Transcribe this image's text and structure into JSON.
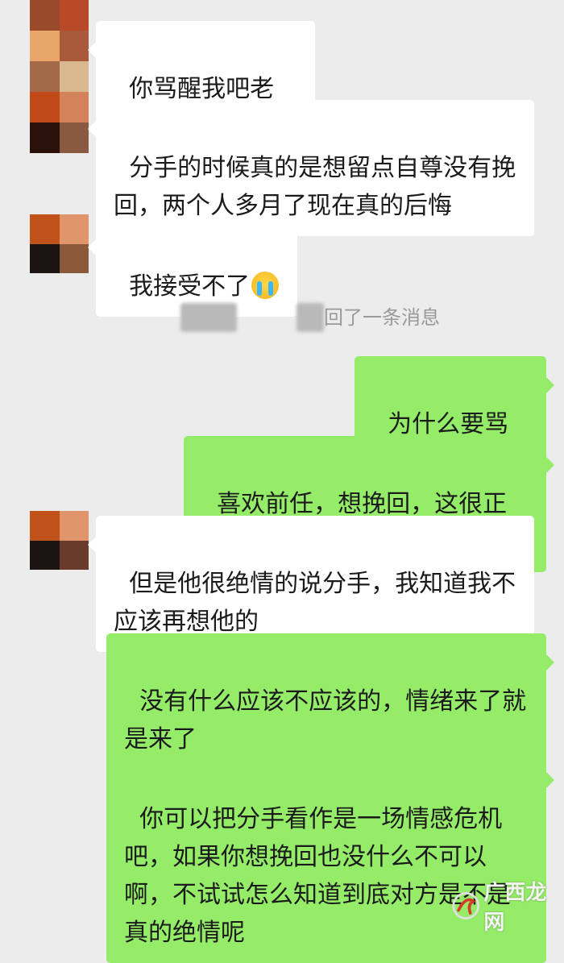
{
  "messages": [
    {
      "side": "in",
      "text": "你骂醒我吧老师"
    },
    {
      "side": "in",
      "text": "分手的时候真的是想留点自尊没有挽回，两个人多月了现在真的后悔"
    },
    {
      "side": "in",
      "text": "我接受不了",
      "emoji": "crying-face"
    },
    {
      "side": "system",
      "text": "撤回了一条消息"
    },
    {
      "side": "out",
      "text": "为什么要骂你"
    },
    {
      "side": "out",
      "text": "喜欢前任，想挽回，这很正常"
    },
    {
      "side": "in",
      "text": "但是他很绝情的说分手，我知道我不应该再想他的"
    },
    {
      "side": "out",
      "text": "没有什么应该不应该的，情绪来了就是来了"
    },
    {
      "side": "out",
      "text": "你可以把分手看作是一场情感危机吧，如果你想挽回也没什么不可以啊，不试试怎么知道到底对方是不是真的绝情呢"
    }
  ],
  "system_visible_text": "回了一条消息",
  "watermark": {
    "text": "广西龙网",
    "logo_icon": "watermark-logo-icon"
  },
  "colors": {
    "background": "#ececec",
    "incoming_bubble": "#ffffff",
    "outgoing_bubble": "#95ec69",
    "system_text": "#9a9a9a"
  },
  "avatar_colors": {
    "avatar1": [
      "#9a4a2a",
      "#b84a2a",
      "#e8a66a",
      "#a85a3a",
      "#a36a4a",
      "#d9b890",
      "#c24a1a",
      "#d4825a",
      "#2a120a",
      "#8a5a40"
    ],
    "avatar2": [
      "#c2521c",
      "#e0956a",
      "#1c1410",
      "#8a5a3a"
    ],
    "avatar3": [
      "#c2521c",
      "#e0956a",
      "#1c1410",
      "#6a3a2a"
    ]
  }
}
